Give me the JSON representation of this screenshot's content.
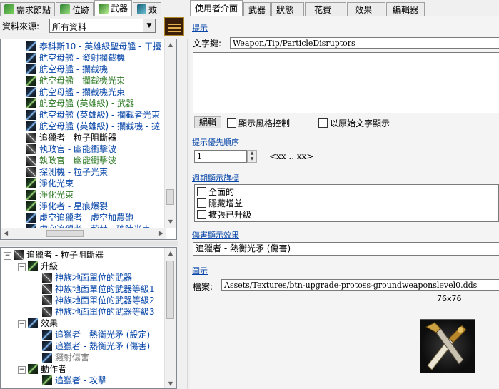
{
  "left_tabs": [
    {
      "label": "需求節點",
      "icon": "node-icon"
    },
    {
      "label": "位跡",
      "icon": "footprint-icon"
    },
    {
      "label": "武器",
      "icon": "weapon-icon"
    },
    {
      "label": "效",
      "icon": "effect-icon"
    }
  ],
  "source": {
    "label": "資料來源:",
    "value": "所有資料"
  },
  "list_items": [
    {
      "text": "泰科斯10 - 英雄級聖母艦 - 干擾",
      "color": "#0645a8",
      "icon": "b"
    },
    {
      "text": "航空母艦 - 發射攔截機",
      "color": "#0645a8",
      "icon": "b"
    },
    {
      "text": "航空母艦 - 攔截機",
      "color": "#0645a8",
      "icon": "b"
    },
    {
      "text": "航空母艦 - 攔截機光束",
      "color": "#2f7b26",
      "icon": "g"
    },
    {
      "text": "航空母艦 - 攔截機光束",
      "color": "#0645a8",
      "icon": "b"
    },
    {
      "text": "航空母艦 (英雄級) - 武器",
      "color": "#2f7b26",
      "icon": "g"
    },
    {
      "text": "航空母艦 (英雄級) - 攔截者光束",
      "color": "#0645a8",
      "icon": "b"
    },
    {
      "text": "航空母艦 (英雄級) - 攔截機 - 撻",
      "color": "#0645a8",
      "icon": "b"
    },
    {
      "text": "追獵者 - 粒子阻斷器",
      "color": "#000000",
      "icon": "x"
    },
    {
      "text": "執政官 - 幽能衝擊波",
      "color": "#0645a8",
      "icon": "x"
    },
    {
      "text": "執政官 - 幽能衝擊波",
      "color": "#2f7b26",
      "icon": "x"
    },
    {
      "text": "探測機 - 粒子光束",
      "color": "#0645a8",
      "icon": "x"
    },
    {
      "text": "淨化光束",
      "color": "#0645a8",
      "icon": "g"
    },
    {
      "text": "淨化光束",
      "color": "#2f7b26",
      "icon": "g"
    },
    {
      "text": "淨化者 - 星痕爆裂",
      "color": "#0645a8",
      "icon": "g"
    },
    {
      "text": "虛空追獵者 - 虛空加農砲",
      "color": "#0645a8",
      "icon": "b"
    },
    {
      "text": "虛空追獵者 - 荊棘 - 破陣光束",
      "color": "#0645a8",
      "icon": "b"
    }
  ],
  "tree": {
    "root": "追獵者 - 粒子阻斷器",
    "upgrades_label": "升級",
    "upgrades": [
      "神族地面單位的武器",
      "神族地面單位的武器等級1",
      "神族地面單位的武器等級2",
      "神族地面單位的武器等級3"
    ],
    "effects_label": "效果",
    "effects": [
      "追獵者 - 熱衡光矛 (設定)",
      "追獵者 - 熱衡光矛 (傷害)",
      "濺射傷害"
    ],
    "actors_label": "動作者",
    "actors": [
      "追獵者 - 攻擊"
    ]
  },
  "right_tabs": [
    "使用者介面",
    "武器",
    "狀態",
    "花費",
    "效果",
    "編輯器"
  ],
  "hint_section": "提示",
  "text_key_label": "文字鍵:",
  "text_key_value": "Weapon/Tip/ParticleDisruptors",
  "edit_button": "編輯",
  "show_style_control": "顯示風格控制",
  "show_raw_text": "以原始文字顯示",
  "priority_section": "提示優先順序",
  "priority_value": "1",
  "priority_range": "<xx .. xx>",
  "periodic_section": "週期顯示旗標",
  "periodic_flags": [
    "全面的",
    "隱藏增益",
    "擴張已升級"
  ],
  "damage_section": "傷害顯示效果",
  "damage_value": "追獵者 - 熱衡光矛 (傷害)",
  "icon_section": "圖示",
  "file_label": "檔案:",
  "file_value": "Assets/Textures/btn-upgrade-protoss-groundweaponslevel0.dds",
  "icon_size": "76x76"
}
